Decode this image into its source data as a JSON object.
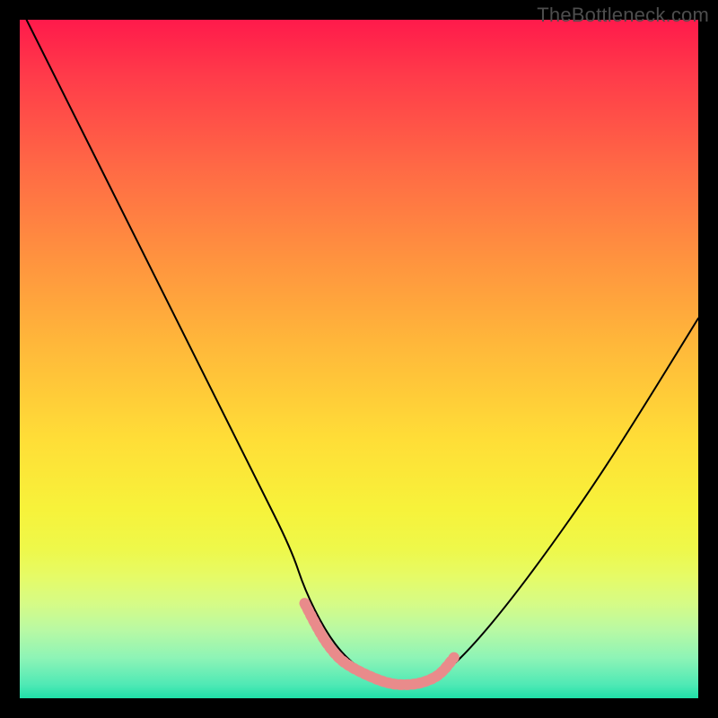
{
  "watermark": "TheBottleneck.com",
  "chart_data": {
    "type": "line",
    "title": "",
    "xlabel": "",
    "ylabel": "",
    "xlim": [
      0,
      100
    ],
    "ylim": [
      0,
      100
    ],
    "grid": false,
    "legend": false,
    "series": [
      {
        "name": "bottleneck-curve",
        "x": [
          1,
          5,
          10,
          15,
          20,
          25,
          30,
          35,
          40,
          42,
          45,
          48,
          52,
          55,
          58,
          60,
          63,
          67,
          72,
          78,
          85,
          92,
          100
        ],
        "y": [
          100,
          92,
          82,
          72,
          62,
          52,
          42,
          32,
          22,
          16,
          10,
          6,
          3,
          2,
          2,
          2.5,
          4,
          8,
          14,
          22,
          32,
          43,
          56
        ],
        "color": "#000000",
        "stroke_width": 2
      },
      {
        "name": "optimal-highlight",
        "x": [
          42,
          44,
          46,
          48,
          52,
          55,
          58,
          60,
          62,
          64
        ],
        "y": [
          14,
          10,
          7,
          5,
          3,
          2,
          2,
          2.5,
          3.5,
          6
        ],
        "color": "#e98b8b",
        "stroke_width": 12,
        "style": "rounded-markers"
      }
    ],
    "background_gradient": {
      "top": "#ff1a4b",
      "mid": "#ffde37",
      "bottom": "#1fe0a8"
    }
  }
}
